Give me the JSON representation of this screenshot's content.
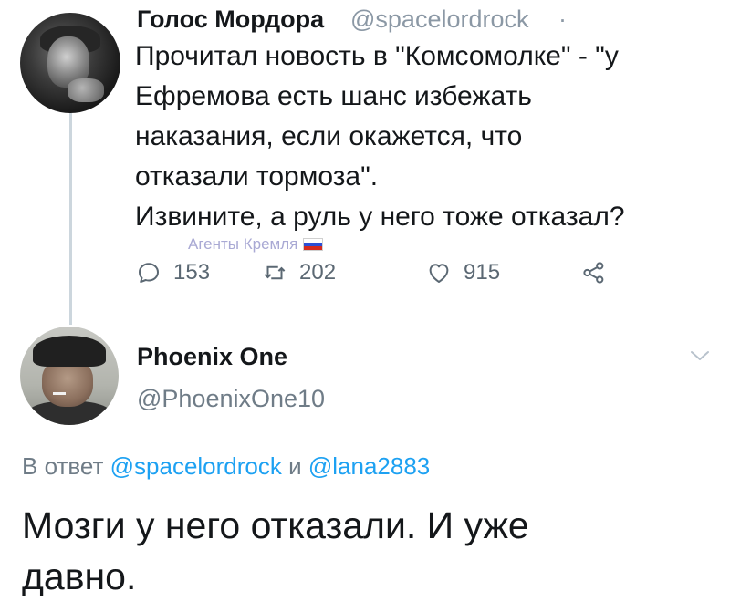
{
  "original_tweet": {
    "display_name": "Голос Мордора",
    "handle": "@spacelordrock",
    "separator": "·",
    "text_lines": [
      "Прочитал новость в \"Комсомолке\" - \"у",
      "Ефремова есть шанс избежать",
      "наказания, если окажется, что",
      "отказали тормоза\".",
      "Извините, а руль у него тоже отказал?"
    ],
    "actions": {
      "reply_count": "153",
      "retweet_count": "202",
      "like_count": "915"
    }
  },
  "watermark": {
    "text": "Агенты Кремля",
    "flag_colors": [
      "#ffffff",
      "#2b4fd6",
      "#d52b1e"
    ]
  },
  "reply_tweet": {
    "display_name": "Phoenix One",
    "handle": "@PhoenixOne10",
    "reply_prefix": "В ответ",
    "reply_user_1": "@spacelordrock",
    "reply_conjunction": "и",
    "reply_user_2": "@lana2883",
    "text_lines": [
      "Мозги у него отказали. И уже",
      "давно."
    ]
  },
  "colors": {
    "link": "#1da1f2",
    "muted": "#8b98a5",
    "thread_line": "#ccd6dd",
    "text": "#14171a"
  },
  "icons": {
    "reply": "reply-icon",
    "retweet": "retweet-icon",
    "like": "heart-icon",
    "share": "share-icon",
    "more": "chevron-down-icon"
  }
}
